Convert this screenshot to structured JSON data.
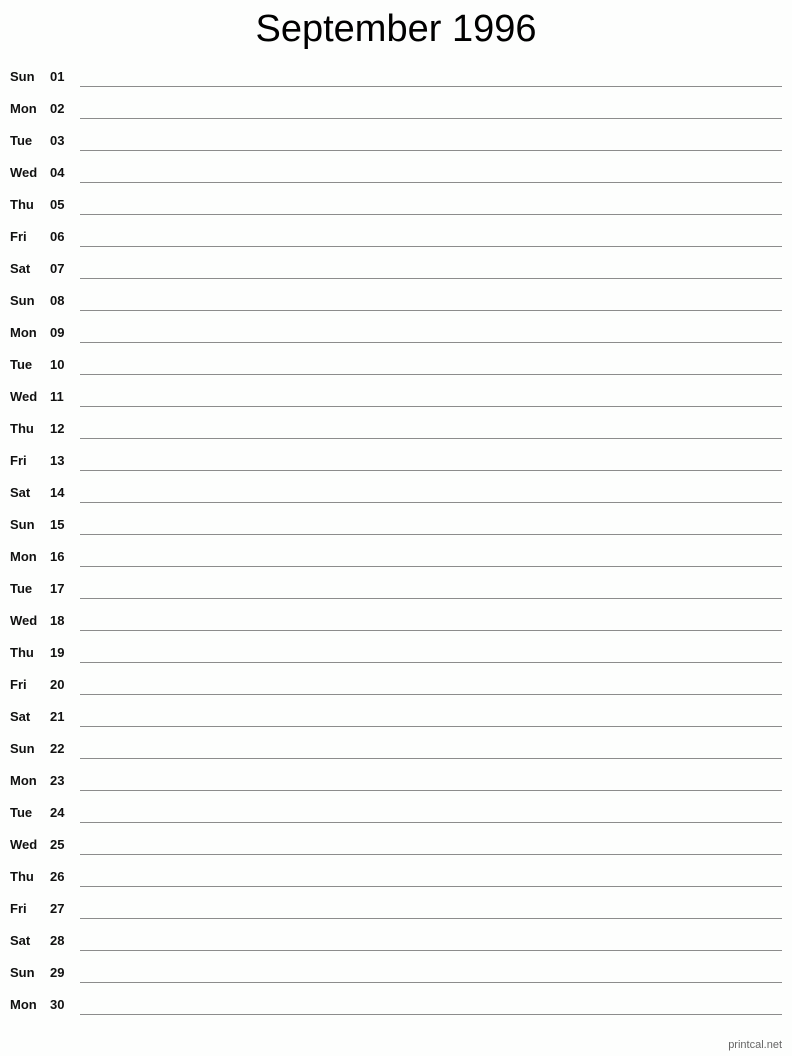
{
  "title": "September 1996",
  "days": [
    {
      "dow": "Sun",
      "num": "01"
    },
    {
      "dow": "Mon",
      "num": "02"
    },
    {
      "dow": "Tue",
      "num": "03"
    },
    {
      "dow": "Wed",
      "num": "04"
    },
    {
      "dow": "Thu",
      "num": "05"
    },
    {
      "dow": "Fri",
      "num": "06"
    },
    {
      "dow": "Sat",
      "num": "07"
    },
    {
      "dow": "Sun",
      "num": "08"
    },
    {
      "dow": "Mon",
      "num": "09"
    },
    {
      "dow": "Tue",
      "num": "10"
    },
    {
      "dow": "Wed",
      "num": "11"
    },
    {
      "dow": "Thu",
      "num": "12"
    },
    {
      "dow": "Fri",
      "num": "13"
    },
    {
      "dow": "Sat",
      "num": "14"
    },
    {
      "dow": "Sun",
      "num": "15"
    },
    {
      "dow": "Mon",
      "num": "16"
    },
    {
      "dow": "Tue",
      "num": "17"
    },
    {
      "dow": "Wed",
      "num": "18"
    },
    {
      "dow": "Thu",
      "num": "19"
    },
    {
      "dow": "Fri",
      "num": "20"
    },
    {
      "dow": "Sat",
      "num": "21"
    },
    {
      "dow": "Sun",
      "num": "22"
    },
    {
      "dow": "Mon",
      "num": "23"
    },
    {
      "dow": "Tue",
      "num": "24"
    },
    {
      "dow": "Wed",
      "num": "25"
    },
    {
      "dow": "Thu",
      "num": "26"
    },
    {
      "dow": "Fri",
      "num": "27"
    },
    {
      "dow": "Sat",
      "num": "28"
    },
    {
      "dow": "Sun",
      "num": "29"
    },
    {
      "dow": "Mon",
      "num": "30"
    }
  ],
  "footer": "printcal.net"
}
